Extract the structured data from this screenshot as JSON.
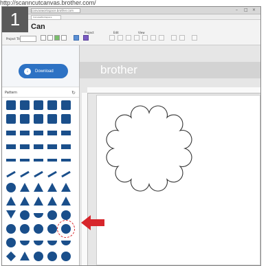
{
  "url_text": "http://scanncutcanvas.brother.com/",
  "step_number": "1",
  "browser": {
    "address": "canvasworkspace.brother.com",
    "tab_label": "CanvasWorkspace",
    "window_controls": [
      "–",
      "□",
      "×"
    ]
  },
  "app": {
    "logo": "Can",
    "menu": [
      "Project",
      "Edit",
      "View"
    ],
    "project_title_label": "Project Title",
    "toolbar_icons": [
      "new-file-icon",
      "open-icon",
      "image-icon",
      "save-icon",
      "shape-icon",
      "pointer-icon",
      "pen-icon",
      "text-icon",
      "group-icon",
      "ungroup-icon",
      "align-icon",
      "arrange-icon",
      "weld-icon",
      "undo-icon",
      "redo-icon",
      "zoom-icon"
    ]
  },
  "sidebar": {
    "download_label": "Download",
    "pattern_label": "Pattern",
    "pattern_rows": [
      [
        "sq",
        "sq",
        "sq",
        "sq",
        "sq"
      ],
      [
        "sq",
        "sq",
        "sq",
        "sq",
        "sq"
      ],
      [
        "bar",
        "bar",
        "bar",
        "bar",
        "bar"
      ],
      [
        "bar",
        "bar",
        "bar",
        "bar",
        "bar"
      ],
      [
        "thin",
        "thin",
        "thin",
        "thin",
        "thin"
      ],
      [
        "slash",
        "slash",
        "slash",
        "slash",
        "slash"
      ],
      [
        "drop",
        "tri",
        "tri",
        "tri",
        "tri"
      ],
      [
        "tri",
        "tri",
        "tri",
        "tri",
        "tri"
      ],
      [
        "tri-down",
        "circle",
        "half",
        "circle",
        "circle"
      ],
      [
        "circle",
        "circle",
        "circle",
        "circle",
        "circle"
      ],
      [
        "circle",
        "half",
        "half",
        "half",
        "half"
      ],
      [
        "diamond",
        "tri",
        "circle",
        "circle",
        "circle"
      ],
      [
        "circle",
        "circle",
        "circle",
        "circle",
        "circle"
      ]
    ],
    "selected_pattern": "scalloped-circle"
  },
  "canvas": {
    "brand_text": "brother",
    "shape": "scalloped-circle"
  },
  "colors": {
    "accent": "#2d72c4",
    "pattern": "#1a4f8b",
    "highlight": "#d7262c"
  }
}
